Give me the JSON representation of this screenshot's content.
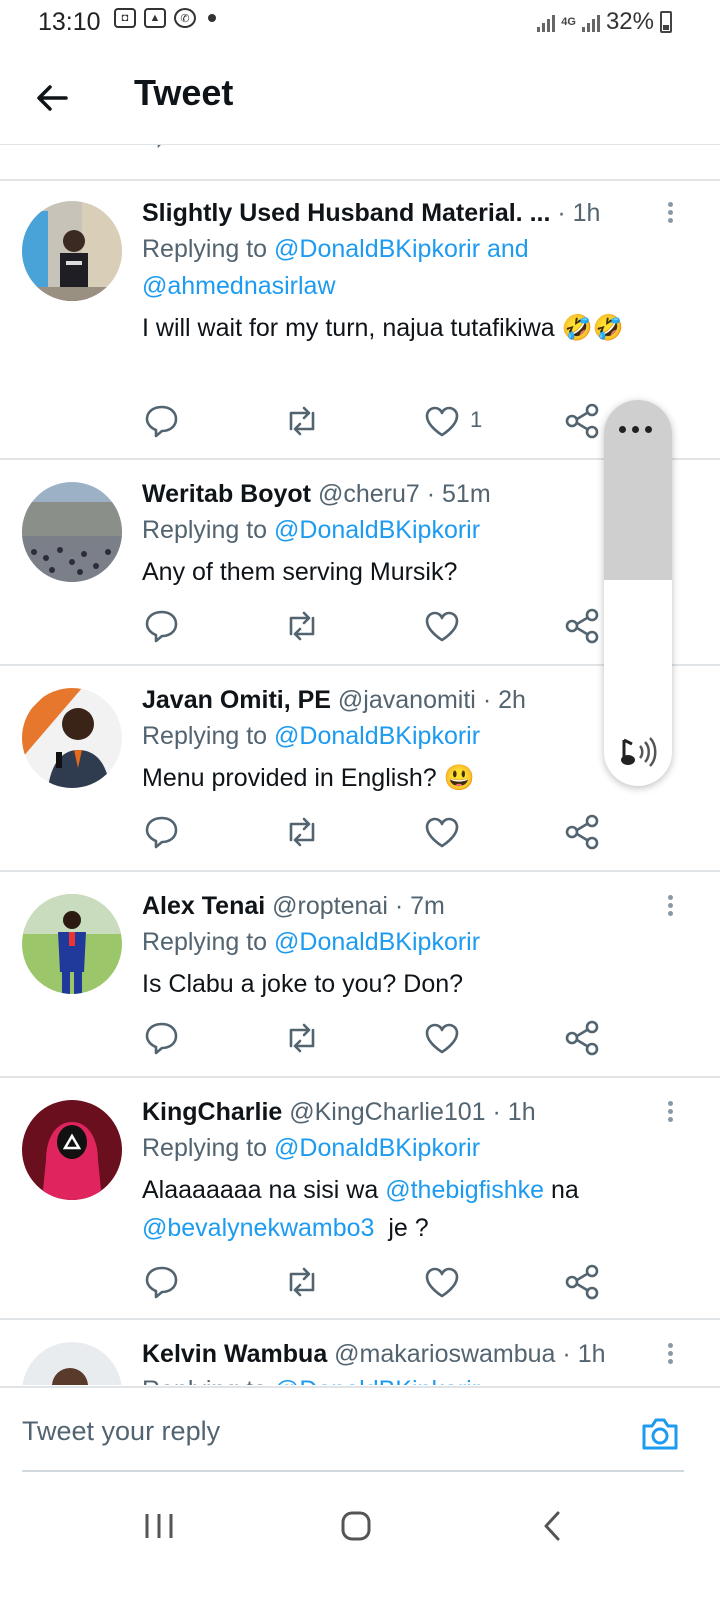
{
  "status_bar": {
    "time": "13:10",
    "network": "4G",
    "battery": "32%"
  },
  "header": {
    "title": "Tweet"
  },
  "tweets": [
    {
      "name": "Slightly Used Husband Material. ...",
      "handle": "",
      "time": "· 1h",
      "replying_prefix": "Replying to ",
      "replying_to": "@DonaldBKipkorir and @ahmednasirlaw",
      "text": "I will wait for my turn, najua tutafikiwa 🤣🤣",
      "like_count": "1"
    },
    {
      "name": "Weritab Boyot",
      "handle": "@cheru7",
      "time": "· 51m",
      "replying_prefix": "Replying to ",
      "replying_to": "@DonaldBKipkorir",
      "text": "Any of them serving Mursik?",
      "like_count": ""
    },
    {
      "name": "Javan Omiti, PE",
      "handle": "@javanomiti",
      "time": "· 2h",
      "replying_prefix": "Replying to ",
      "replying_to": "@DonaldBKipkorir",
      "text": "Menu provided in English? 😃",
      "like_count": ""
    },
    {
      "name": "Alex Tenai",
      "handle": "@roptenai",
      "time": "· 7m",
      "replying_prefix": "Replying to ",
      "replying_to": "@DonaldBKipkorir",
      "text": "Is Clabu a joke to you? Don?",
      "like_count": ""
    },
    {
      "name": "KingCharlie",
      "handle": "@KingCharlie101",
      "time": "· 1h",
      "replying_prefix": "Replying to ",
      "replying_to": "@DonaldBKipkorir",
      "text_parts": [
        "Alaaaaaaa na sisi wa ",
        "@thebigfishke",
        " na ",
        "@bevalynekwambo3",
        "  je ?"
      ],
      "like_count": ""
    },
    {
      "name": "Kelvin Wambua",
      "handle": "@makarioswambua",
      "time": "· 1h",
      "replying_prefix": "Replying to ",
      "replying_to": "@DonaldBKipkorir"
    }
  ],
  "reply_bar": {
    "placeholder": "Tweet your reply"
  },
  "colors": {
    "accent": "#1d9bf0",
    "muted": "#536471",
    "divider": "#e1e4e6"
  }
}
